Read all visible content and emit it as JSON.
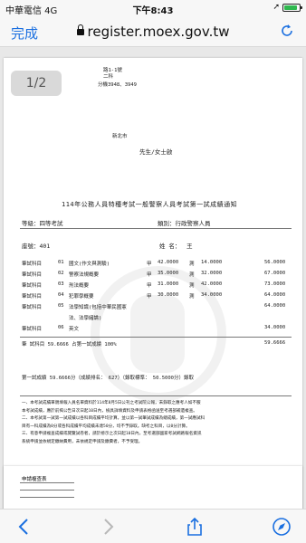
{
  "status": {
    "carrier": "中華電信  4G",
    "time": "下午8:43",
    "battery_level": 0.85
  },
  "nav": {
    "done_label": "完成",
    "url": "register.moex.gov.tw"
  },
  "viewer": {
    "page_indicator": "1/2"
  },
  "doc": {
    "header_line1": "路1-1號",
    "header_line2": "二科",
    "header_line3": "分機3948、3949",
    "recipient_city": "新北市",
    "recipient_name": "先生/女士啟",
    "title": "114年公務人員特種考試一般警察人員考試第一試成績通知",
    "grade": "等級：四等考試",
    "category": "類別：行政警察人員",
    "seat": "座號：401",
    "name_label": "姓  名：",
    "name_value": "王 ",
    "subjects": [
      {
        "type": "筆試科目",
        "code": "01",
        "name": "國文(作文與測驗)",
        "mark": "甲",
        "score": "42.0000",
        "times": "測",
        "weighted": "14.0000",
        "right": "56.0000"
      },
      {
        "type": "筆試科目",
        "code": "02",
        "name": "警察法規概要",
        "mark": "甲",
        "score": "35.0000",
        "times": "測",
        "weighted": "32.0000",
        "right": "67.0000"
      },
      {
        "type": "筆試科目",
        "code": "03",
        "name": "刑法概要",
        "mark": "甲",
        "score": "31.0000",
        "times": "測",
        "weighted": "42.0000",
        "right": "73.0000"
      },
      {
        "type": "筆試科目",
        "code": "04",
        "name": "犯罪學概要",
        "mark": "甲",
        "score": "30.0000",
        "times": "測",
        "weighted": "34.0000",
        "right": "64.0000"
      },
      {
        "type": "筆試科目",
        "code": "05",
        "name": "法學知識(包括中華民國憲",
        "mark": "",
        "score": "",
        "times": "",
        "weighted": "",
        "right": "64.0000"
      },
      {
        "type": "",
        "code": "",
        "name": "法、法學緒論)",
        "mark": "",
        "score": "",
        "times": "",
        "weighted": "",
        "right": ""
      },
      {
        "type": "筆試科目",
        "code": "06",
        "name": "英文",
        "mark": "",
        "score": "",
        "times": "",
        "weighted": "",
        "right": "34.0000"
      }
    ],
    "total_row_label": "筆   試科目 59.6666 占第一試成績  100%",
    "total_row_right": "59.6666",
    "result_line": "第一試成績        59.6666分（成績排名：    627）（錄取標準： 50.5000分）錄取",
    "notes": [
      "一、本考試成績單親填報入員名單資料於114年8月5日公刊之考試院公報，未錄取之應考人如不服",
      "    本考試成績，應於前揭公告日次日起10日內，檢具詳填資料及申請表格函送至考選部補遺複查。",
      "二、本考試第一試第一試成績以各科目成績平均計算，並以第一試筆試成績為總成績，第一試應試科",
      "    目有一科成績為0分或各科成績平均成績未達50分，均不予錄取。缺考之科目，以0分計算。",
      "三、有意申請複查成績或閱覽試卷者，請於榜示之次日起10日內，至考選部國家考試網路報名資訊",
      "    系統申請並依規定繳納費用，未依規定申請及繳費者，不予受理。"
    ],
    "page2_title": "申請複查表"
  }
}
